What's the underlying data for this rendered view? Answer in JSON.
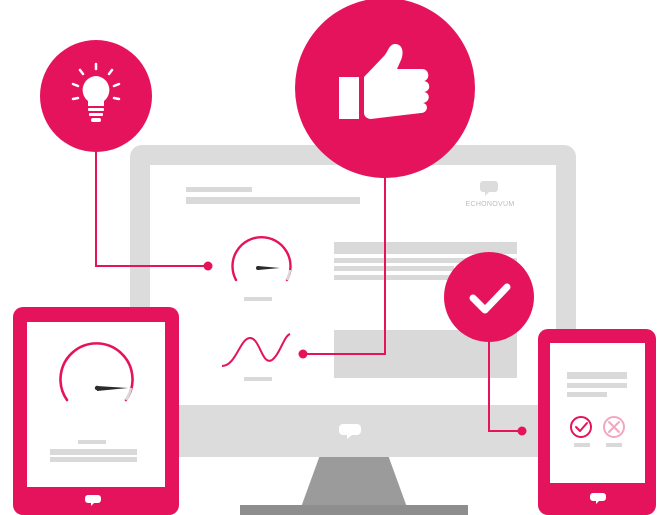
{
  "brand": {
    "logo_text": "ECHONOVUM"
  },
  "colors": {
    "accent": "#E5135B",
    "accent_light": "#F2A7C0",
    "frame_gray": "#DCDCDC",
    "bar_gray": "#D9D9D9",
    "stand_gray": "#9B9B9B",
    "screen": "#FFFFFF"
  },
  "icons": {
    "idea": "lightbulb-icon",
    "approval": "thumbs-up-icon",
    "confirmation": "checkmark-icon",
    "accept": "check-circle-icon",
    "reject": "x-circle-icon",
    "chat": "speech-bubble-icon",
    "gauge": "gauge-icon",
    "wave": "sine-wave-icon"
  }
}
